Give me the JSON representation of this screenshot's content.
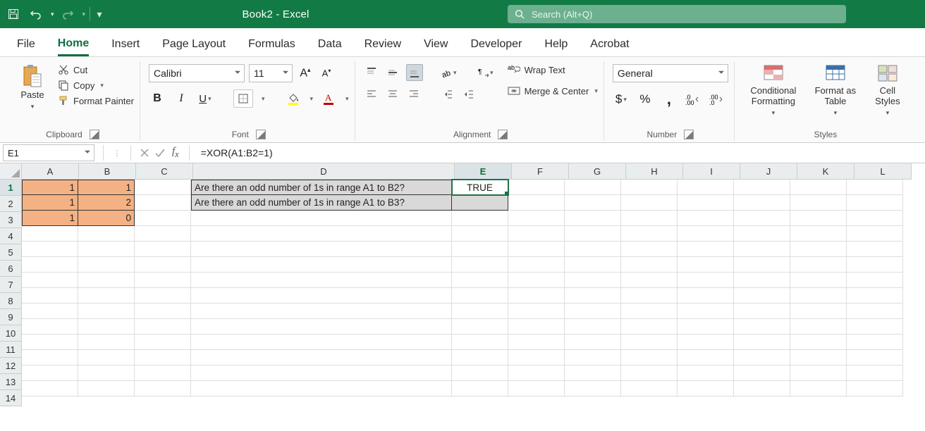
{
  "title": "Book2  -  Excel",
  "search_placeholder": "Search (Alt+Q)",
  "tabs": [
    "File",
    "Home",
    "Insert",
    "Page Layout",
    "Formulas",
    "Data",
    "Review",
    "View",
    "Developer",
    "Help",
    "Acrobat"
  ],
  "active_tab": "Home",
  "clipboard": {
    "paste": "Paste",
    "cut": "Cut",
    "copy": "Copy",
    "format_painter": "Format Painter",
    "label": "Clipboard"
  },
  "font": {
    "name": "Calibri",
    "size": "11",
    "label": "Font"
  },
  "alignment": {
    "wrap": "Wrap Text",
    "merge": "Merge & Center",
    "label": "Alignment"
  },
  "number": {
    "format": "General",
    "label": "Number"
  },
  "styles": {
    "cond": "Conditional Formatting",
    "table": "Format as Table",
    "cell": "Cell Styles",
    "label": "Styles"
  },
  "name_box": "E1",
  "formula": "=XOR(A1:B2=1)",
  "columns": [
    "A",
    "B",
    "C",
    "D",
    "E",
    "F",
    "G",
    "H",
    "I",
    "J",
    "K",
    "L"
  ],
  "rows": 14,
  "active_col": "E",
  "active_row": 1,
  "cells": {
    "A1": "1",
    "B1": "1",
    "A2": "1",
    "B2": "2",
    "A3": "1",
    "B3": "0",
    "D1": "Are there an odd number of 1s in range A1 to B2?",
    "D2": "Are there an odd number of 1s in range A1 to B3?",
    "E1": "TRUE"
  },
  "chart_data": {
    "type": "table",
    "cells": {
      "A1": 1,
      "B1": 1,
      "A2": 1,
      "B2": 2,
      "A3": 1,
      "B3": 0,
      "D1": "Are there an odd number of 1s in range A1 to B2?",
      "D2": "Are there an odd number of 1s in range A1 to B3?",
      "E1": "TRUE"
    },
    "formulas": {
      "E1": "=XOR(A1:B2=1)"
    },
    "highlighted_range": "A1:B3"
  }
}
